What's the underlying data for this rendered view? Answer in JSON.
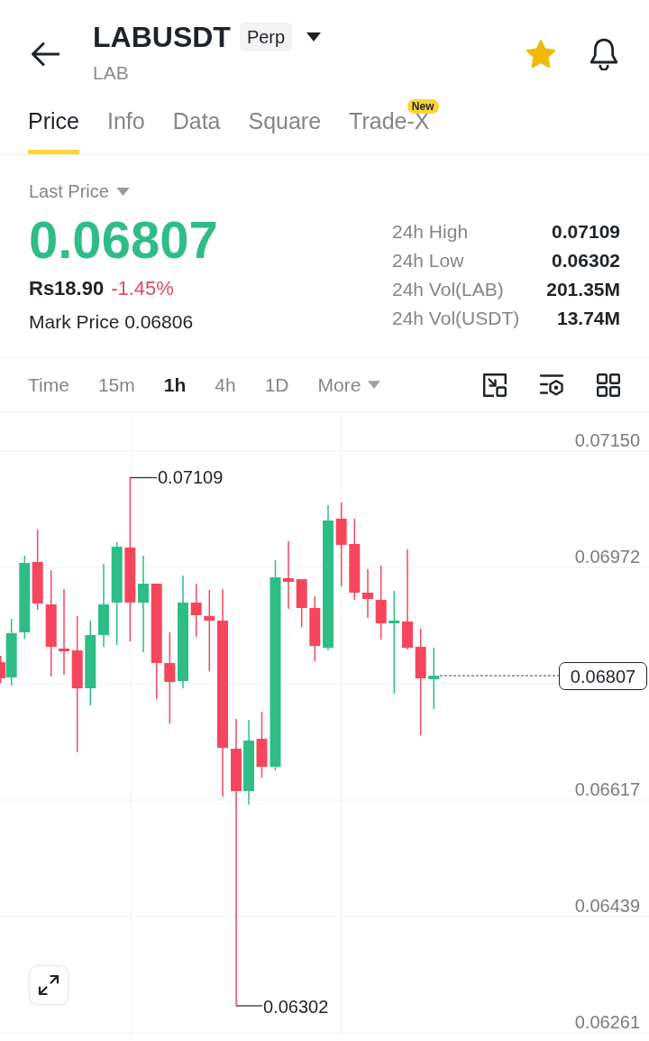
{
  "header": {
    "title": "LABUSDT",
    "badge": "Perp",
    "subtitle": "LAB",
    "favorite": true
  },
  "tabs": [
    {
      "label": "Price",
      "selected": true
    },
    {
      "label": "Info",
      "selected": false
    },
    {
      "label": "Data",
      "selected": false
    },
    {
      "label": "Square",
      "selected": false
    },
    {
      "label": "Trade-X",
      "selected": false,
      "badge": "New"
    }
  ],
  "ticker": {
    "price_type": "Last Price",
    "last_price": "0.06807",
    "fiat_price": "Rs18.90",
    "change": "-1.45%",
    "mark_price": "Mark Price 0.06806",
    "stats": [
      {
        "label": "24h High",
        "value": "0.07109"
      },
      {
        "label": "24h Low",
        "value": "0.06302"
      },
      {
        "label": "24h Vol(LAB)",
        "value": "201.35M"
      },
      {
        "label": "24h Vol(USDT)",
        "value": "13.74M"
      }
    ]
  },
  "chart_toolbar": {
    "intervals": [
      {
        "label": "Time",
        "kind": "option",
        "selected": false
      },
      {
        "label": "15m",
        "kind": "option",
        "selected": false
      },
      {
        "label": "1h",
        "kind": "option",
        "selected": true
      },
      {
        "label": "4h",
        "kind": "option",
        "selected": false
      },
      {
        "label": "1D",
        "kind": "option",
        "selected": false
      },
      {
        "label": "More",
        "kind": "dropdown",
        "selected": false
      }
    ]
  },
  "chart": {
    "axis_labels": [
      "0.07150",
      "0.06972",
      "0.06617",
      "0.06439",
      "0.06261"
    ],
    "high_label": "0.07109",
    "low_label": "0.06302",
    "current_price": "0.06807"
  }
}
